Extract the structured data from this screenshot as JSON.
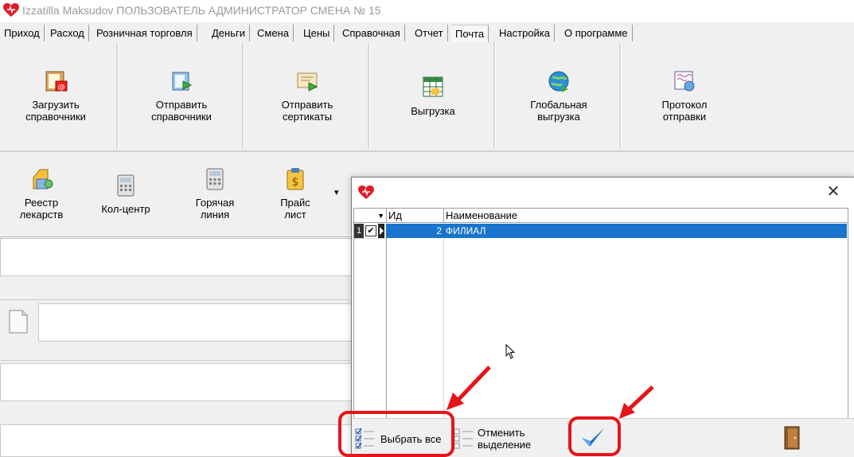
{
  "window": {
    "title": "Izzatilla Maksudov ПОЛЬЗОВАТЕЛЬ АДМИНИСТРАТОР СМЕНА № 15"
  },
  "tabs": [
    "Приход",
    "Расход",
    "Розничная торговля",
    "Деньги",
    "Смена",
    "Цены",
    "Справочная",
    "Отчет",
    "Почта",
    "Настройка",
    "О программе"
  ],
  "active_tab": "Почта",
  "ribbon": {
    "load_refs": "Загрузить\nсправочники",
    "send_refs": "Отправить\nсправочники",
    "send_certs": "Отправить\nсертикаты",
    "export": "Выгрузка",
    "global_export": "Глобальная\nвыгрузка",
    "send_log": "Протокол\nотправки"
  },
  "toolbar2": {
    "registry": "Реестр\nлекарств",
    "callcenter": "Кол-центр",
    "hotline": "Горячая\nлиния",
    "pricelist": "Прайс\nлист",
    "more": "▾"
  },
  "dialog": {
    "close": "✕",
    "columns": {
      "id": "Ид",
      "name": "Наименование"
    },
    "rows": [
      {
        "num": "1",
        "id": "2",
        "name": "ФИЛИАЛ"
      }
    ],
    "select_all": "Выбрать все",
    "deselect": "Отменить\nвыделение"
  },
  "colors": {
    "selection": "#1874cd",
    "callout": "#e5141b"
  }
}
